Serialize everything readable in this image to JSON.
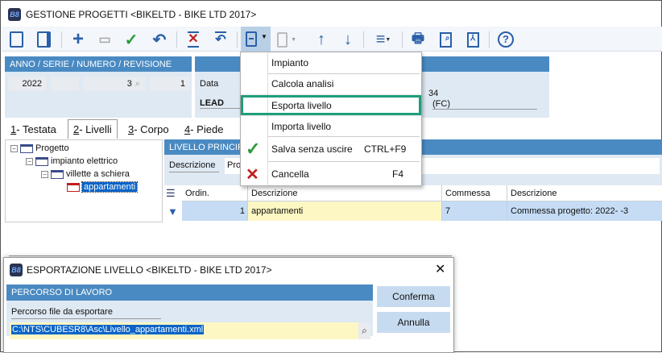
{
  "window": {
    "title": "GESTIONE PROGETTI <BIKELTD - BIKE LTD 2017>",
    "logo": "B8"
  },
  "toolbar": {
    "icons": [
      "panel-left-icon",
      "panel-right-icon",
      "add-icon",
      "open-folder-icon",
      "save-check-icon",
      "undo-icon",
      "delete-icon",
      "restore-icon",
      "document-menu-icon",
      "document-disabled-icon",
      "arrow-up-icon",
      "arrow-down-icon",
      "hamburger-menu-icon",
      "print-icon",
      "print-preview-icon",
      "pdf-icon",
      "help-icon"
    ]
  },
  "header": {
    "left_title": "ANNO / SERIE / NUMERO / REVISIONE",
    "anno": "2022",
    "serie": "",
    "numero": "3",
    "revisione": "1",
    "data_label": "Data",
    "lead_label": "LEAD",
    "partial1": "34",
    "partial2": "(FC)"
  },
  "tabs": [
    {
      "key": "1",
      "label": " - Testata"
    },
    {
      "key": "2",
      "label": " - Livelli"
    },
    {
      "key": "3",
      "label": " - Corpo"
    },
    {
      "key": "4",
      "label": " - Piede"
    }
  ],
  "tree": [
    "Progetto",
    "impianto elettrico",
    "villette a schiera",
    "appartamenti"
  ],
  "level_panel": {
    "title": "LIVELLO PRINCIPA",
    "descr_label": "Descrizione",
    "descr_value": "Pro"
  },
  "grid": {
    "columns": [
      "Ordin.",
      "Descrizione",
      "Commessa",
      "Descrizione"
    ],
    "rows": [
      [
        "1",
        "appartamenti",
        "7",
        "Commessa progetto: 2022- -3"
      ]
    ]
  },
  "menu": {
    "items": [
      {
        "label": "Impianto",
        "shortcut": ""
      },
      {
        "label": "Calcola analisi",
        "shortcut": ""
      },
      {
        "label": "Esporta livello",
        "shortcut": ""
      },
      {
        "label": "Importa livello",
        "shortcut": ""
      },
      {
        "label": "Salva senza uscire",
        "shortcut": "CTRL+F9"
      },
      {
        "label": "Cancella",
        "shortcut": "F4"
      }
    ]
  },
  "dialog": {
    "title": "ESPORTAZIONE LIVELLO <BIKELTD - BIKE LTD 2017>",
    "section": "PERCORSO DI LAVORO",
    "field_label": "Percorso file da esportare",
    "path": "C:\\NTS\\CUBESR8\\Asc\\Livello_appartamenti.xml",
    "confirm": "Conferma",
    "cancel": "Annulla",
    "close": "✕"
  },
  "colors": {
    "accent": "#4a8ac2",
    "highlight": "#1e9e7a",
    "selection": "#0a64c8"
  }
}
